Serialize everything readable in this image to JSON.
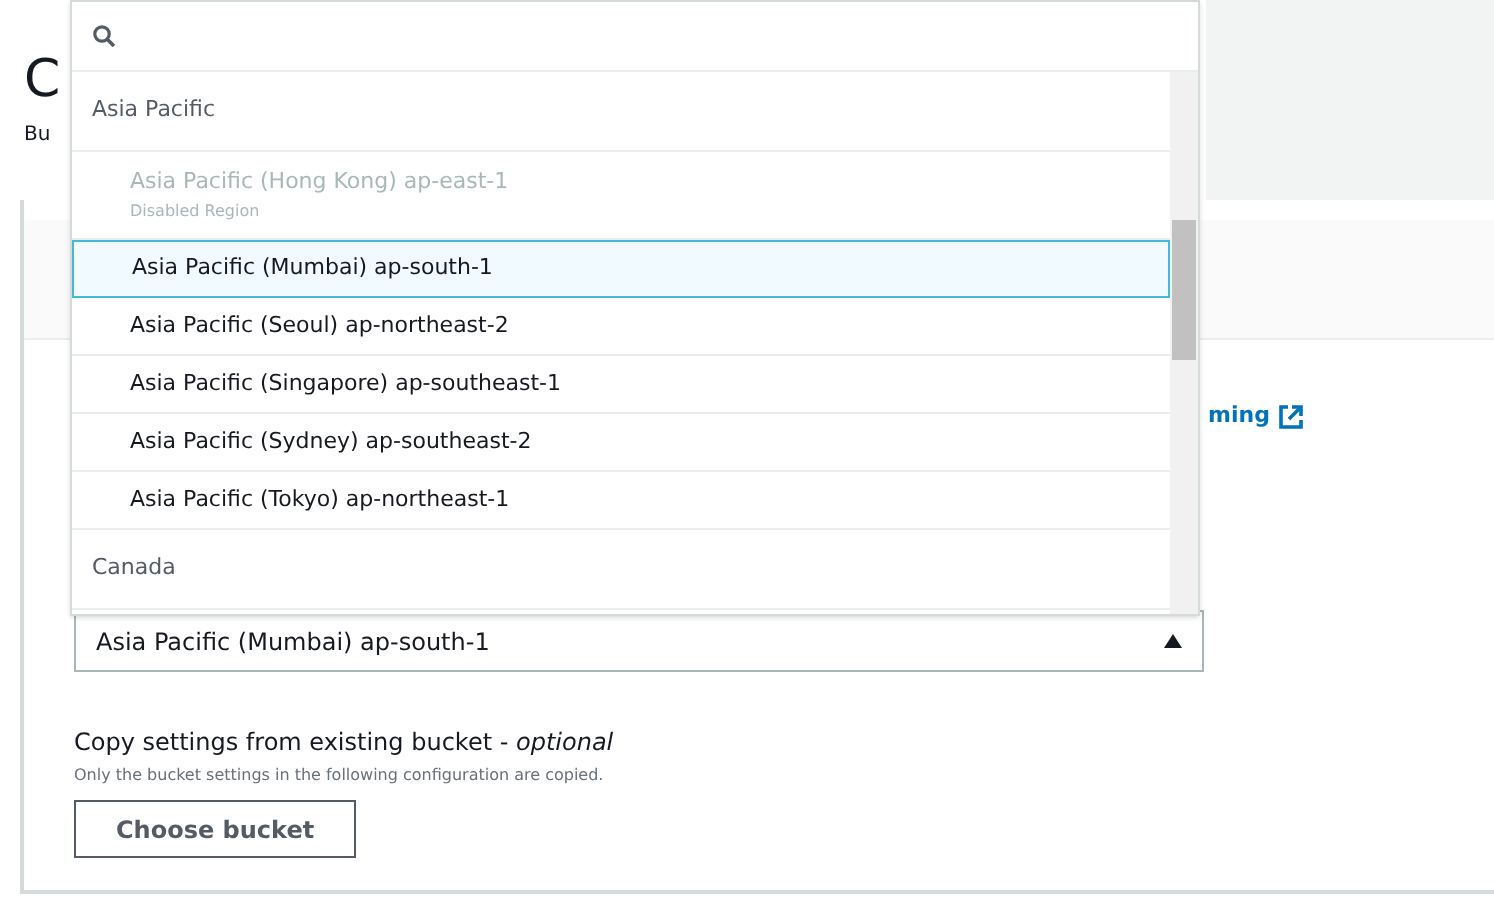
{
  "page": {
    "title": "C",
    "subtitle": "Bu"
  },
  "link": {
    "text": "ming"
  },
  "region_select": {
    "value": "Asia Pacific (Mumbai) ap-south-1",
    "expanded": true
  },
  "dropdown": {
    "groups": [
      {
        "label": "Asia Pacific",
        "options": [
          {
            "label": "Asia Pacific (Hong Kong) ap-east-1",
            "note": "Disabled Region",
            "disabled": true,
            "selected": false
          },
          {
            "label": "Asia Pacific (Mumbai) ap-south-1",
            "disabled": false,
            "selected": true
          },
          {
            "label": "Asia Pacific (Seoul) ap-northeast-2",
            "disabled": false,
            "selected": false
          },
          {
            "label": "Asia Pacific (Singapore) ap-southeast-1",
            "disabled": false,
            "selected": false
          },
          {
            "label": "Asia Pacific (Sydney) ap-southeast-2",
            "disabled": false,
            "selected": false
          },
          {
            "label": "Asia Pacific (Tokyo) ap-northeast-1",
            "disabled": false,
            "selected": false
          }
        ]
      },
      {
        "label": "Canada"
      }
    ]
  },
  "copy_settings": {
    "label": "Copy settings from existing bucket - *optional*",
    "hint": "Only the bucket settings in the following configuration are copied.",
    "button": "Choose bucket"
  }
}
